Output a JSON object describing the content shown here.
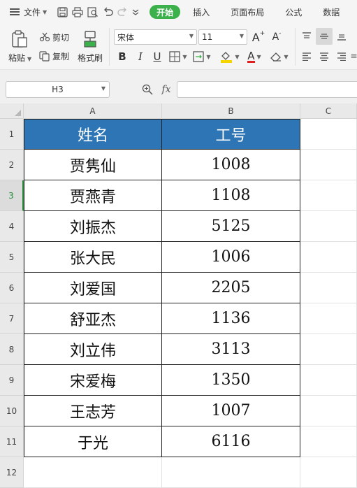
{
  "menubar": {
    "file_label": "文件",
    "tabs": [
      "开始",
      "插入",
      "页面布局",
      "公式",
      "数据"
    ]
  },
  "ribbon": {
    "paste_label": "粘贴",
    "cut_label": "剪切",
    "copy_label": "复制",
    "format_painter_label": "格式刷",
    "font_name": "宋体",
    "font_size": "11",
    "font_color": "#e02020",
    "fill_color": "#f5d400"
  },
  "formula_bar": {
    "name_box": "H3",
    "fx_label": "fx",
    "formula": ""
  },
  "sheet": {
    "columns": [
      "A",
      "B",
      "C"
    ],
    "rows": [
      "1",
      "2",
      "3",
      "4",
      "5",
      "6",
      "7",
      "8",
      "9",
      "10",
      "11",
      "12"
    ],
    "selected_row": "3",
    "header_fill": "#2e75b6",
    "header": [
      "姓名",
      "工号"
    ],
    "data": [
      [
        "贾隽仙",
        "1008"
      ],
      [
        "贾燕青",
        "1108"
      ],
      [
        "刘振杰",
        "5125"
      ],
      [
        "张大民",
        "1006"
      ],
      [
        "刘爱国",
        "2205"
      ],
      [
        "舒亚杰",
        "1136"
      ],
      [
        "刘立伟",
        "3113"
      ],
      [
        "宋爱梅",
        "1350"
      ],
      [
        "王志芳",
        "1007"
      ],
      [
        "于光",
        "6116"
      ]
    ]
  }
}
